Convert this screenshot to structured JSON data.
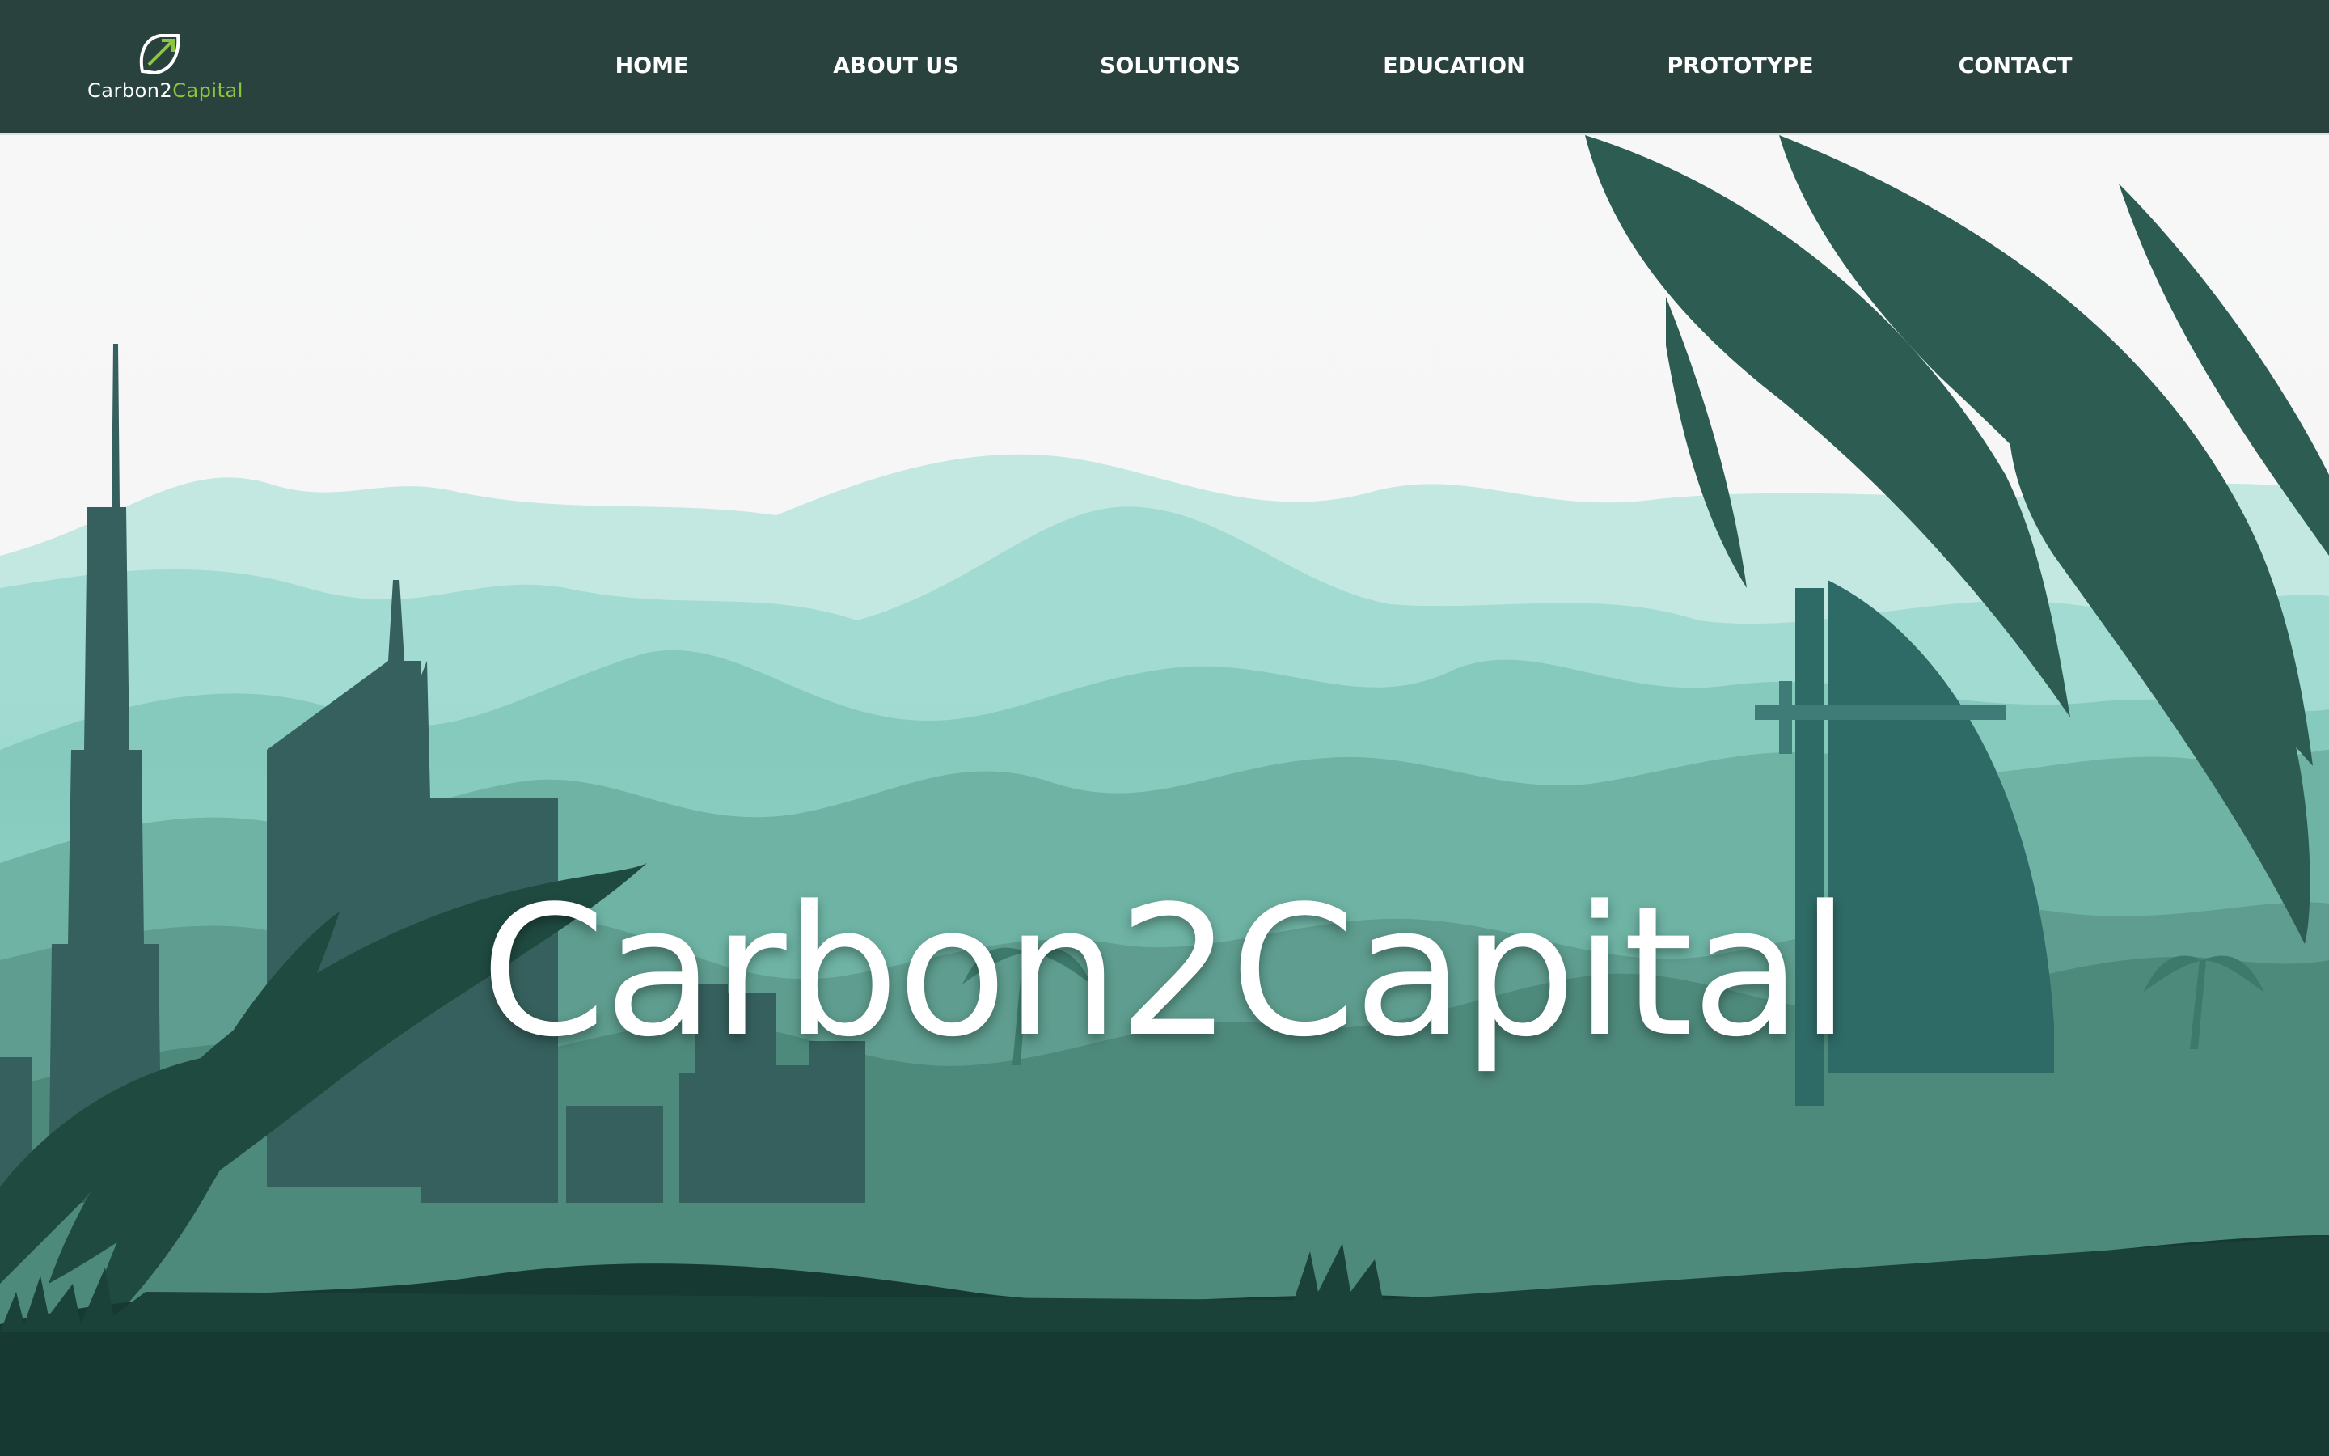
{
  "brand": {
    "name_part1": "Carbon2",
    "name_part2": "Capital",
    "logo_icon": "leaf-growth-arrow-icon",
    "accent_color": "#8cc63f"
  },
  "nav": {
    "items": [
      {
        "label": "HOME"
      },
      {
        "label": "ABOUT US"
      },
      {
        "label": "SOLUTIONS"
      },
      {
        "label": "EDUCATION"
      },
      {
        "label": "PROTOTYPE"
      },
      {
        "label": "CONTACT"
      }
    ],
    "background": "#2a423d"
  },
  "hero": {
    "title": "Carbon2Capital",
    "illustration": "city-skyline-rainforest-landscape"
  }
}
